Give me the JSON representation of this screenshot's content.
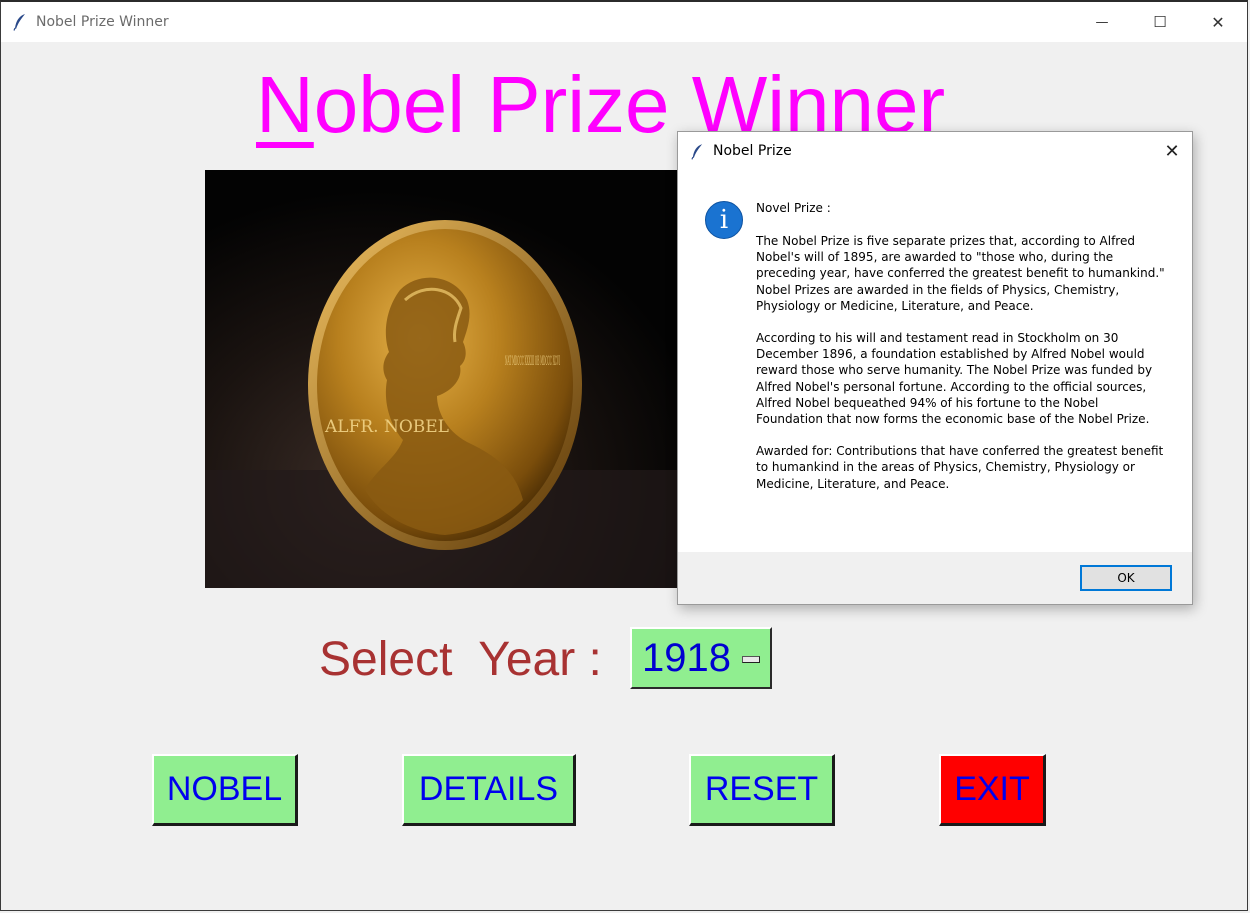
{
  "window": {
    "title": "Nobel Prize Winner",
    "minimize_glyph": "—",
    "maximize_glyph": "☐",
    "close_glyph": "✕"
  },
  "main": {
    "title_first_letter": "N",
    "title_rest": "obel Prize Winner",
    "image_alt": "Nobel medal",
    "medal_inscription_left": "ALFR. NOBEL",
    "medal_inscription_right": "NAT MDCCC XXXIII OB MDCCC XCVI",
    "year_label": "Select  Year :",
    "year_value": "1918",
    "buttons": {
      "nobel": "NOBEL",
      "details": "DETAILS",
      "reset": "RESET",
      "exit": "EXIT"
    }
  },
  "dialog": {
    "title": "Nobel Prize",
    "close_glyph": "✕",
    "icon_glyph": "i",
    "heading": "Novel Prize :",
    "paragraphs": [
      "The Nobel Prize is five separate prizes that, according to Alfred Nobel's will of 1895, are awarded to \"those who, during the preceding year, have conferred the greatest benefit to humankind.\" Nobel Prizes are awarded in the fields of Physics, Chemistry, Physiology or Medicine, Literature, and Peace.",
      "According to his will and testament read in Stockholm on 30 December 1896, a foundation established by Alfred Nobel would reward those who serve humanity. The Nobel Prize was funded by Alfred Nobel's personal fortune. According to the official sources, Alfred Nobel bequeathed 94% of his fortune to the Nobel Foundation that now forms the economic base of the Nobel Prize.",
      "Awarded for: Contributions that have conferred the greatest benefit to humankind in the areas of Physics, Chemistry, Physiology or Medicine, Literature, and Peace."
    ],
    "ok_label": "OK"
  },
  "colors": {
    "title": "#ff00ff",
    "year_label": "#a83232",
    "button_bg": "#90ee90",
    "button_text": "#0000ee",
    "exit_bg": "#ff0000",
    "info_icon": "#1a73d1"
  }
}
